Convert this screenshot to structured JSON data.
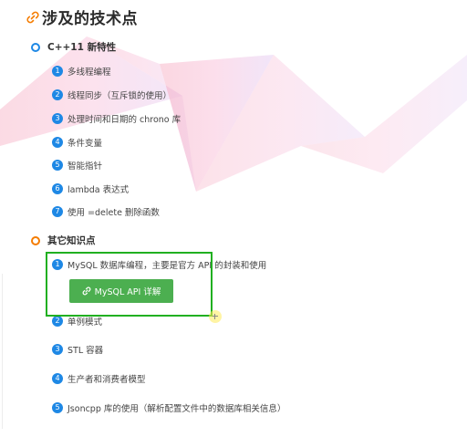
{
  "title": "涉及的技术点",
  "sections": [
    {
      "label": "C++11 新特性",
      "items": [
        {
          "num": "1",
          "text": "多线程编程"
        },
        {
          "num": "2",
          "text": "线程同步（互斥锁的使用）"
        },
        {
          "num": "3",
          "text": "处理时间和日期的 chrono 库"
        },
        {
          "num": "4",
          "text": "条件变量"
        },
        {
          "num": "5",
          "text": "智能指针"
        },
        {
          "num": "6",
          "text": "lambda 表达式"
        },
        {
          "num": "7",
          "text": "使用 =delete 删除函数"
        }
      ]
    },
    {
      "label": "其它知识点",
      "items": [
        {
          "num": "1",
          "text": "MySQL 数据库编程，主要是官方 API 的封装和使用"
        },
        {
          "num": "2",
          "text": "单例模式"
        },
        {
          "num": "3",
          "text": "STL 容器"
        },
        {
          "num": "4",
          "text": "生产者和消费者模型"
        },
        {
          "num": "5",
          "text": "Jsoncpp 库的使用（解析配置文件中的数据库相关信息）"
        }
      ]
    }
  ],
  "api_button": {
    "label": "MySQL API 详解",
    "icon": "link-icon"
  },
  "colors": {
    "number_badge": "#1e88e5",
    "section1_marker": "#1e88e5",
    "section2_marker": "#f57c00",
    "button": "#4caf50",
    "highlight_border": "#21b021",
    "title_icon": "#f57c00"
  }
}
